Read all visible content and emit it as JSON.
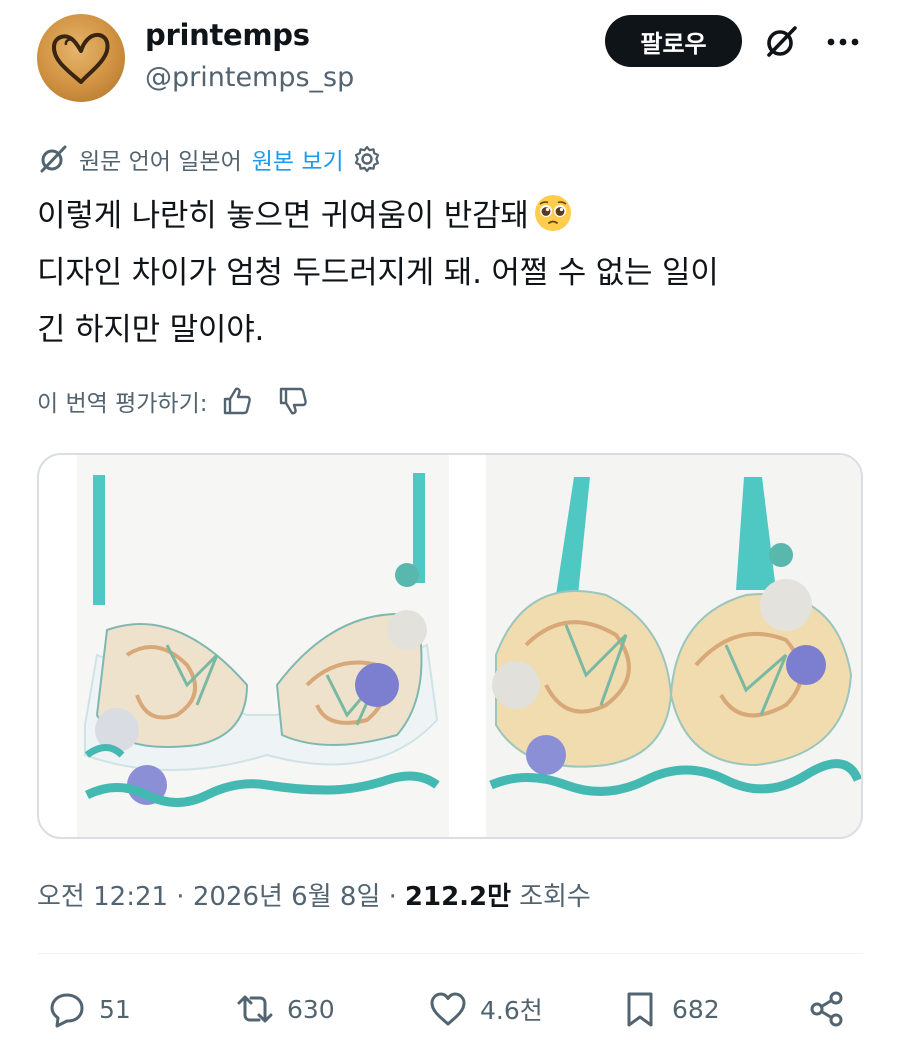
{
  "author": {
    "display_name": "printemps",
    "handle": "@printemps_sp",
    "avatar_icon": "heart-drawing-avatar"
  },
  "header": {
    "follow_label": "팔로우",
    "grok_icon": "grok-slash-icon",
    "more_icon": "more-dots-icon"
  },
  "translation": {
    "source_text": "원문 언어 일본어",
    "show_original_label": "원본 보기",
    "settings_icon": "gear-icon",
    "rate_prompt": "이 번역 평가하기:",
    "thumbs_up_icon": "thumbs-up-icon",
    "thumbs_down_icon": "thumbs-down-icon"
  },
  "tweet": {
    "line1": "이렇게 나란히 놓으면 귀여움이 반감돼",
    "line1_emoji": "pleading-face-emoji",
    "line2": "디자인 차이가 엄청 두드러지게 돼. 어쩔 수 없는 일이",
    "line3": "긴 하지만 말이야."
  },
  "media": {
    "images": [
      "bra-photo-front",
      "bra-photo-angled"
    ]
  },
  "meta": {
    "timestamp": "오전 12:21 · 2026년 6월 8일 ·",
    "views_count": "212.2만",
    "views_label": "조회수"
  },
  "actions": {
    "reply_count": "51",
    "retweet_count": "630",
    "like_count": "4.6천",
    "bookmark_count": "682"
  },
  "colors": {
    "link_blue": "#1d9bf0",
    "secondary_text": "#536471",
    "primary_text": "#0f1419",
    "teal_strap": "#4fc8c4"
  }
}
